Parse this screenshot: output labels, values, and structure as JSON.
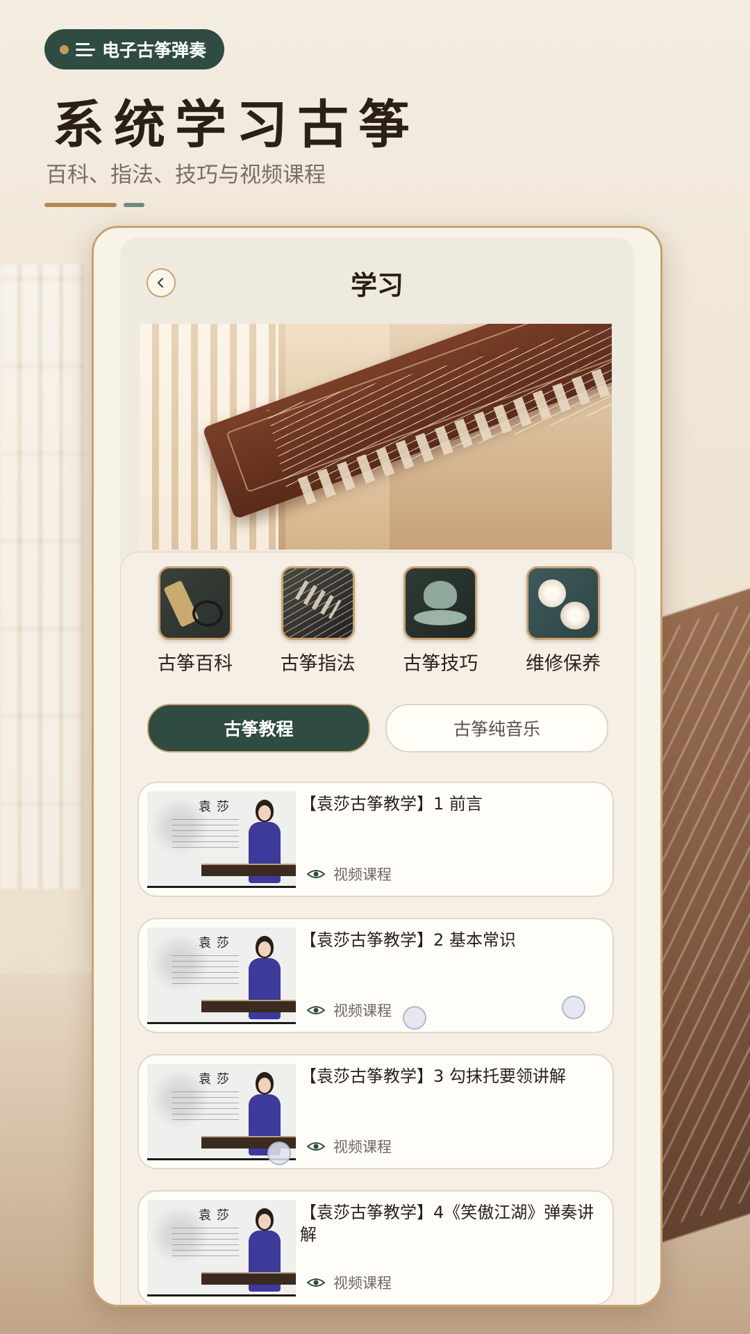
{
  "header": {
    "brand_label": "电子古筝弹奏",
    "hero_title": "系统学习古筝",
    "hero_subtitle": "百科、指法、技巧与视频课程"
  },
  "screen": {
    "title": "学习",
    "categories": [
      {
        "label": "古筝百科",
        "icon": "encyclopedia-scroll-icon"
      },
      {
        "label": "古筝指法",
        "icon": "fingering-strings-icon"
      },
      {
        "label": "古筝技巧",
        "icon": "teapot-icon"
      },
      {
        "label": "维修保养",
        "icon": "magnolia-icon"
      }
    ],
    "tabs": [
      {
        "label": "古筝教程",
        "active": true
      },
      {
        "label": "古筝纯音乐",
        "active": false
      }
    ],
    "lessons": [
      {
        "title": "【袁莎古筝教学】1 前言",
        "meta": "视频课程",
        "thumb_name": "袁莎"
      },
      {
        "title": "【袁莎古筝教学】2 基本常识",
        "meta": "视频课程",
        "thumb_name": "袁莎"
      },
      {
        "title": "【袁莎古筝教学】3 勾抹托要领讲解",
        "meta": "视频课程",
        "thumb_name": "袁莎"
      },
      {
        "title": "【袁莎古筝教学】4《笑傲江湖》弹奏讲解",
        "meta": "视频课程",
        "thumb_name": "袁莎"
      }
    ]
  },
  "colors": {
    "accent_green": "#2f4b42",
    "accent_gold": "#c9a170",
    "background": "#f3ece0"
  }
}
